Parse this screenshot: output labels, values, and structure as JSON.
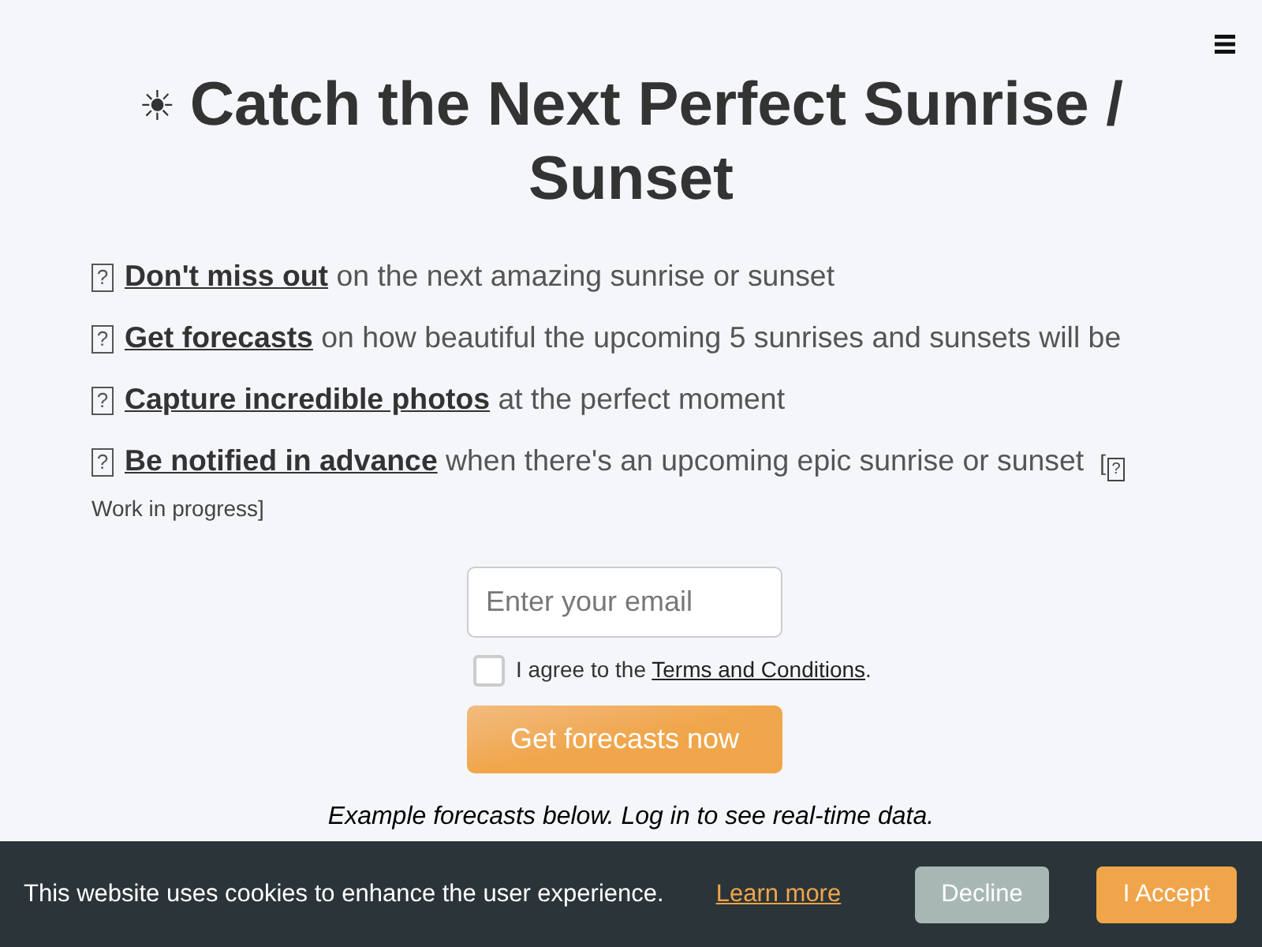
{
  "heading": {
    "icon": "☀",
    "title": "Catch the Next Perfect Sunrise / Sunset"
  },
  "features": [
    {
      "glyph": "?",
      "text": "**Don't miss out** on the next amazing sunrise or sunset"
    },
    {
      "glyph": "?",
      "text": "**Get forecasts** on how beautiful the upcoming 5 sunrises and sunsets will be"
    },
    {
      "glyph": "?",
      "text": "**Capture incredible photos** at the perfect moment"
    },
    {
      "glyph": "?",
      "text": "**Be notified in advance** when there's an upcoming epic sunrise or sunset",
      "note": {
        "prefix": "[",
        "glyph": "?",
        "text": "Work in progress]"
      }
    }
  ],
  "signup": {
    "email": {
      "placeholder": "Enter your email"
    },
    "agree": {
      "checked": false,
      "text": "I agree to the ",
      "link": "Terms and Conditions",
      "suffix": "."
    },
    "button": "Get forecasts now"
  },
  "example_note": "Example forecasts below. Log in to see real-time data.",
  "cookie_banner": {
    "message": "This website uses cookies to enhance the user experience.",
    "link": "Learn more",
    "buttons": [
      {
        "label": "Decline",
        "kind": "decline"
      },
      {
        "label": "I Accept",
        "kind": "accept"
      }
    ]
  }
}
